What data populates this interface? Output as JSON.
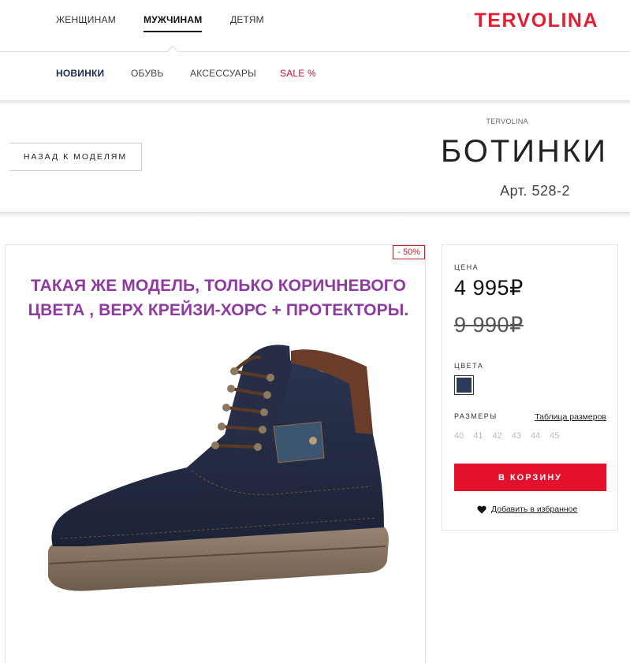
{
  "top_nav": {
    "items": [
      "ЖЕНЩИНАМ",
      "МУЖЧИНАМ",
      "ДЕТЯМ"
    ],
    "active": "МУЖЧИНАМ",
    "logo": "TERVOLINA"
  },
  "sub_nav": {
    "items": [
      "НОВИНКИ",
      "ОБУВЬ",
      "АКСЕССУАРЫ",
      "SALE %"
    ]
  },
  "product_header": {
    "back_label": "НАЗАД К МОДЕЛЯМ",
    "brand": "TERVOLINA",
    "title": "БОТИНКИ",
    "article": "Арт. 528-2"
  },
  "image_panel": {
    "discount": "- 50%",
    "overlay_text": "ТАКАЯ ЖЕ МОДЕЛЬ, ТОЛЬКО КОРИЧНЕВОГО ЦВЕТА , ВЕРХ КРЕЙЗИ-ХОРС + ПРОТЕКТОРЫ."
  },
  "buy_panel": {
    "price_label": "ЦЕНА",
    "price": "4 995₽",
    "old_price": "9 990₽",
    "colors_label": "ЦВЕТА",
    "sizes_label": "РАЗМЕРЫ",
    "size_table_link": "Таблица размеров",
    "sizes": [
      "40",
      "41",
      "42",
      "43",
      "44",
      "45"
    ],
    "cart_button": "В КОРЗИНУ",
    "favorite_link": "Добавить в избранное"
  },
  "colors": {
    "brand_red": "#e31e32",
    "overlay_purple": "#8e3aa0",
    "swatch_navy": "#2c3a5c"
  }
}
